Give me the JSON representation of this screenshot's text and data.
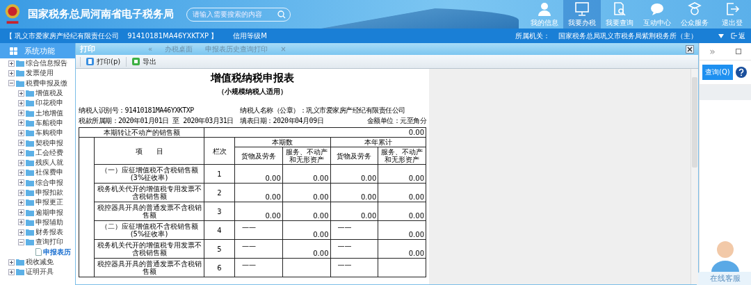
{
  "header": {
    "title": "国家税务总局河南省电子税务局",
    "search": {
      "placeholder": "请输入需要搜索的内容"
    },
    "nav": [
      {
        "label": "我的信息",
        "selected": false
      },
      {
        "label": "我要办税",
        "selected": true
      },
      {
        "label": "我要查询",
        "selected": false
      },
      {
        "label": "互动中心",
        "selected": false
      },
      {
        "label": "公众服务",
        "selected": false
      },
      {
        "label": "退出登",
        "selected": false
      }
    ]
  },
  "info_bar": {
    "company": "【 巩义市爱家房产经纪有限责任公司",
    "tax_id": "91410181MA46YXKTXP 】",
    "credit": "信用等级M",
    "authority_label": "所属机关：",
    "authority": "国家税务总局巩义市税务局紫荆税务所（主）",
    "back": "返"
  },
  "sidebar": {
    "title": "系统功能",
    "items": [
      {
        "label": "综合信息报告",
        "expanded": false,
        "selected": false
      },
      {
        "label": "发票使用",
        "expanded": false,
        "selected": false
      },
      {
        "label": "税费申报及缴",
        "expanded": true,
        "selected": false,
        "children": [
          {
            "label": "增值税及",
            "expanded": false,
            "selected": false
          },
          {
            "label": "印花税申",
            "expanded": false,
            "selected": false
          },
          {
            "label": "土地增值",
            "expanded": false,
            "selected": false
          },
          {
            "label": "车船税申",
            "expanded": false,
            "selected": false
          },
          {
            "label": "车购税申",
            "expanded": false,
            "selected": false
          },
          {
            "label": "契税申报",
            "expanded": false,
            "selected": false
          },
          {
            "label": "工会经费",
            "expanded": false,
            "selected": false
          },
          {
            "label": "残疾人就",
            "expanded": false,
            "selected": false
          },
          {
            "label": "社保费申",
            "expanded": false,
            "selected": false
          },
          {
            "label": "综合申报",
            "expanded": false,
            "selected": false
          },
          {
            "label": "申报扣款",
            "expanded": false,
            "selected": false
          },
          {
            "label": "申报更正",
            "expanded": false,
            "selected": false
          },
          {
            "label": "逾期申报",
            "expanded": false,
            "selected": false
          },
          {
            "label": "申报辅助",
            "expanded": false,
            "selected": false
          },
          {
            "label": "财务报表",
            "expanded": false,
            "selected": false
          },
          {
            "label": "查询打印",
            "expanded": true,
            "selected": false,
            "children": [
              {
                "label": "申报表历",
                "selected": true
              }
            ]
          }
        ]
      },
      {
        "label": "税收减免",
        "expanded": false,
        "selected": false
      },
      {
        "label": "证明开具",
        "expanded": false,
        "selected": false
      }
    ]
  },
  "tabs": {
    "prev": "«",
    "items": [
      {
        "label": "办税桌面"
      },
      {
        "label": "申报表历史查询打印"
      }
    ],
    "close": "×"
  },
  "dialog": {
    "title": "打印",
    "toolbar": [
      {
        "label": "打印(p)"
      },
      {
        "label": "导出"
      }
    ],
    "document": {
      "title": "增值税纳税申报表",
      "subtitle": "（小规模纳税人适用）",
      "taxpayer_id": "纳税人识别号：91410181MA46YXKTXP",
      "taxpayer_name": "纳税人名称（公章）：巩义市爱家房产经纪有限责任公司",
      "period": "税款所属期：2020年01月01日 至 2020年03月31日",
      "fill_date": "填表日期：2020年04月09日",
      "unit": "金额单位：元至角分",
      "transfer_label": "本期转让不动产的销售额",
      "transfer_value": "0.00",
      "columns": {
        "item": "项　　目",
        "line": "栏次",
        "current": "本期数",
        "year": "本年累计",
        "current_goods": "货物及劳务",
        "current_services": "服务、不动产和无形资产",
        "year_goods": "货物及劳务",
        "year_services": "服务、不动产和无形资产"
      },
      "rows": [
        {
          "item": "（一）应征增值税不含税销售额(3%征收率)",
          "line": "1",
          "current_goods": "0.00",
          "current_services": "0.00",
          "year_goods": "0.00",
          "year_services": "0.00"
        },
        {
          "item": "税务机关代开的增值税专用发票不含税销售额",
          "line": "2",
          "current_goods": "0.00",
          "current_services": "0.00",
          "year_goods": "0.00",
          "year_services": "0.00"
        },
        {
          "item": "税控器具开具的普通发票不含税销售额",
          "line": "3",
          "current_goods": "0.00",
          "current_services": "0.00",
          "year_goods": "0.00",
          "year_services": "0.00"
        },
        {
          "item": "（二）应征增值税不含税销售额(5%征收率)",
          "line": "4",
          "current_goods": "——",
          "current_services": "0.00",
          "year_goods": "——",
          "year_services": "0.00"
        },
        {
          "item": "税务机关代开的增值税专用发票不含税销售额",
          "line": "5",
          "current_goods": "——",
          "current_services": "0.00",
          "year_goods": "——",
          "year_services": "0.00"
        },
        {
          "item": "税控器具开具的普通发票不含税销售额",
          "line": "6",
          "current_goods": "——",
          "year_goods": "——"
        }
      ]
    }
  },
  "right_panel": {
    "expand": "»",
    "query_button": "查询(Q)",
    "service_label": "在线客服"
  }
}
